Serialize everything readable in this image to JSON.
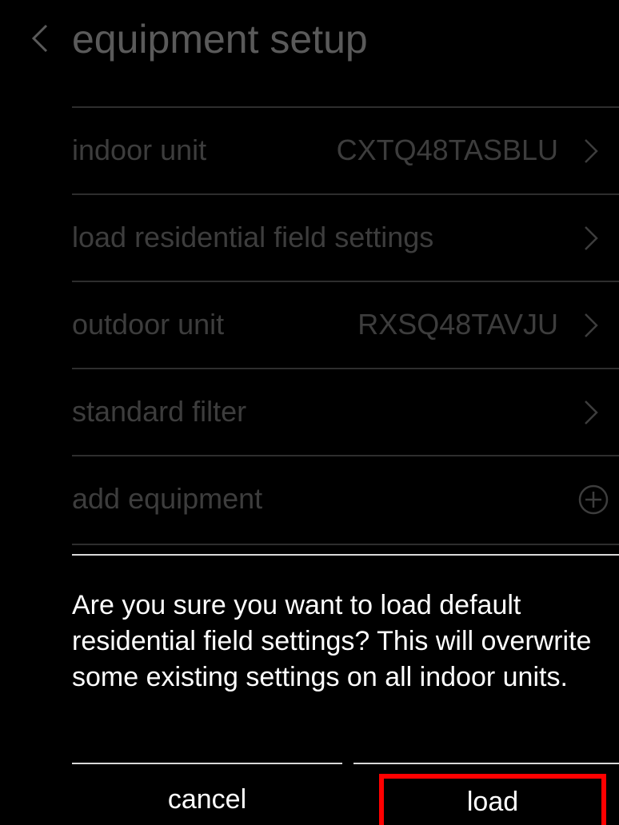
{
  "header": {
    "title": "equipment setup",
    "back_icon": "chevron-left-icon"
  },
  "list": {
    "items": [
      {
        "label": "indoor unit",
        "value": "CXTQ48TASBLU",
        "icon": "chevron-right-icon"
      },
      {
        "label": "load residential field settings",
        "value": "",
        "icon": "chevron-right-icon"
      },
      {
        "label": "outdoor unit",
        "value": "RXSQ48TAVJU",
        "icon": "chevron-right-icon"
      },
      {
        "label": "standard filter",
        "value": "",
        "icon": "chevron-right-icon"
      },
      {
        "label": "add equipment",
        "value": "",
        "icon": "plus-circle-icon"
      }
    ]
  },
  "dialog": {
    "message": "Are you sure you want to load default residential field settings? This will overwrite some existing settings on all indoor units.",
    "cancel_label": "cancel",
    "load_label": "load",
    "highlight_color": "#ff0000"
  }
}
